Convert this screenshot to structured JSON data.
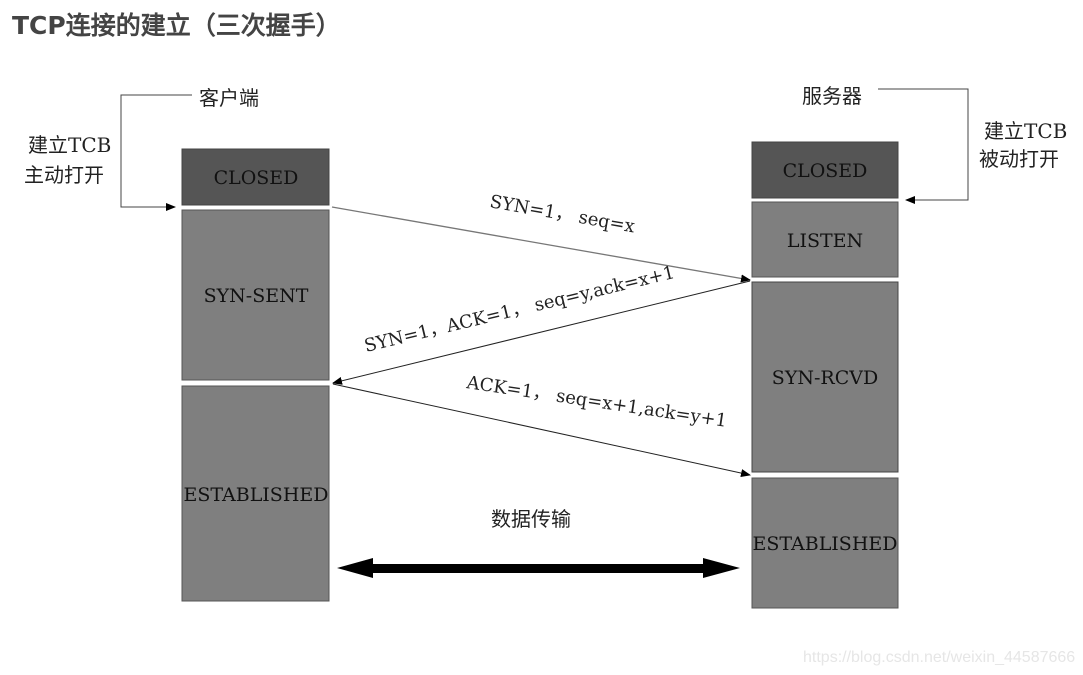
{
  "title": "TCP连接的建立（三次握手）",
  "client": {
    "label": "客户端",
    "open_note": [
      "建立TCB",
      "主动打开"
    ],
    "states": [
      "CLOSED",
      "SYN-SENT",
      "ESTABLISHED"
    ]
  },
  "server": {
    "label": "服务器",
    "open_note": [
      "建立TCB",
      "被动打开"
    ],
    "states": [
      "CLOSED",
      "LISTEN",
      "SYN-RCVD",
      "ESTABLISHED"
    ]
  },
  "messages": [
    {
      "direction": "client-to-server",
      "text": "SYN=1， seq=x"
    },
    {
      "direction": "server-to-client",
      "text": "SYN=1，ACK=1， seq=y,ack=x+1"
    },
    {
      "direction": "client-to-server",
      "text": "ACK=1， seq=x+1,ack=y+1"
    }
  ],
  "data_transfer_label": "数据传输",
  "colors": {
    "closed": "#555555",
    "state": "#7f7f7f",
    "arrow": "#000000"
  },
  "watermark": "https://blog.csdn.net/weixin_44587666"
}
